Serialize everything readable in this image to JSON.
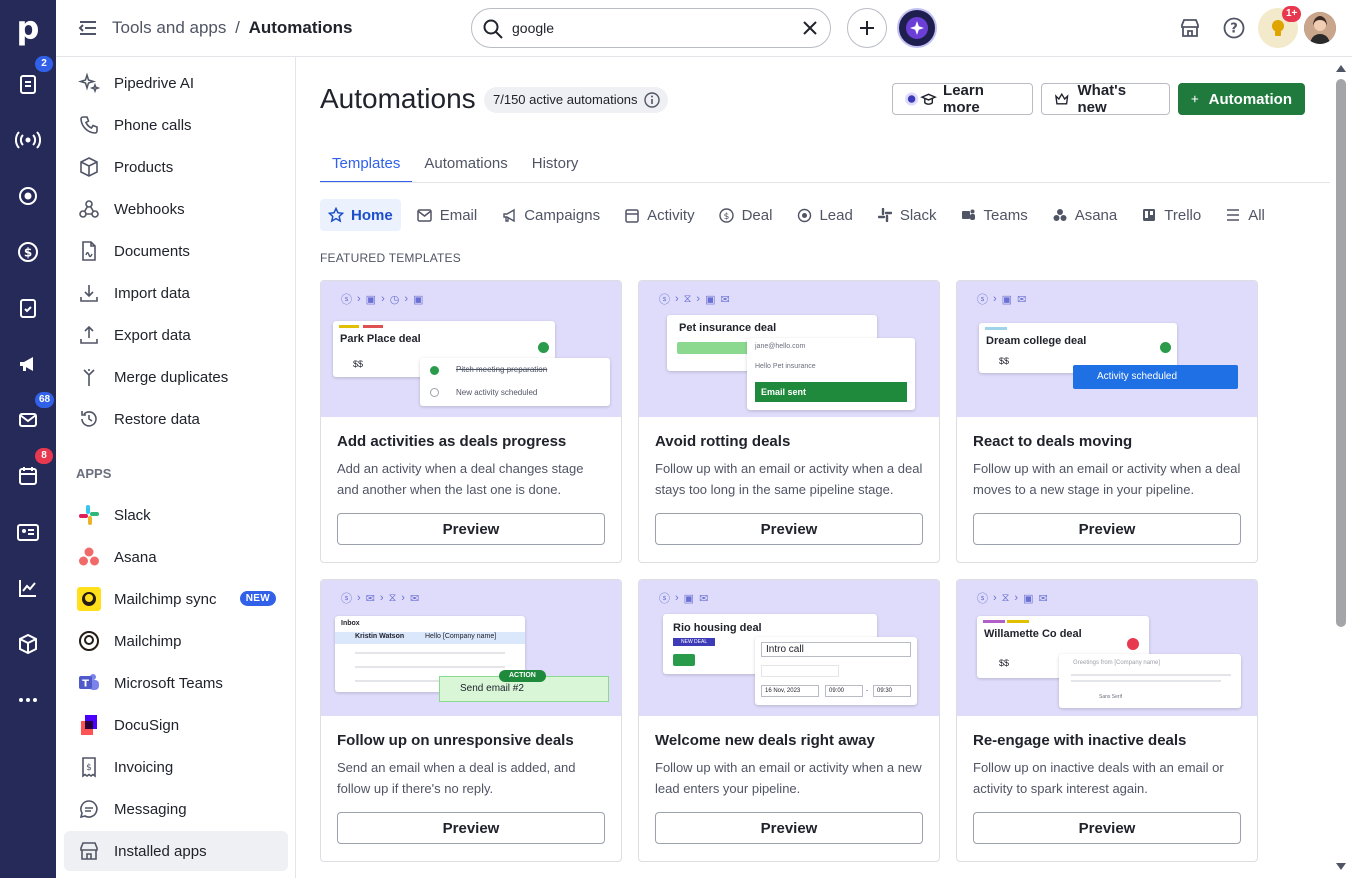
{
  "rail": {
    "logo": "p",
    "badges": {
      "deals": "2",
      "mail": "68",
      "calendar": "8"
    }
  },
  "topbar": {
    "breadcrumb_parent": "Tools and apps",
    "breadcrumb_sep": "/",
    "breadcrumb_current": "Automations",
    "search_value": "google",
    "notif_badge": "1+"
  },
  "sidebar": {
    "items": [
      "Pipedrive AI",
      "Phone calls",
      "Products",
      "Webhooks",
      "Documents",
      "Import data",
      "Export data",
      "Merge duplicates",
      "Restore data"
    ],
    "apps_header": "APPS",
    "apps": [
      "Slack",
      "Asana",
      "Mailchimp sync",
      "Mailchimp",
      "Microsoft Teams",
      "DocuSign",
      "Invoicing",
      "Messaging",
      "Installed apps"
    ],
    "new_badge": "NEW"
  },
  "main": {
    "title": "Automations",
    "count": "7/150 active automations",
    "learn_more": "Learn more",
    "whats_new": "What's new",
    "add_automation": "Automation",
    "tabs": [
      "Templates",
      "Automations",
      "History"
    ],
    "chips": [
      "Home",
      "Email",
      "Campaigns",
      "Activity",
      "Deal",
      "Lead",
      "Slack",
      "Teams",
      "Asana",
      "Trello",
      "All"
    ],
    "featured": "FEATURED TEMPLATES",
    "preview": "Preview",
    "cards": [
      {
        "title": "Add activities as deals progress",
        "desc": "Add an activity when a deal changes stage and another when the last one is done.",
        "mock_title": "Park Place deal",
        "mock_val": "$$",
        "mock_a": "Pitch meeting preparation",
        "mock_b": "New activity scheduled"
      },
      {
        "title": "Avoid rotting deals",
        "desc": "Follow up with an email or activity when a deal stays too long in the same pipeline stage.",
        "mock_title": "Pet insurance deal",
        "mock_a": "jane@hello.com",
        "mock_b": "Hello Pet insurance",
        "mock_c": "Email sent"
      },
      {
        "title": "React to deals moving",
        "desc": "Follow up with an email or activity when a deal moves to a new stage in your pipeline.",
        "mock_title": "Dream college deal",
        "mock_val": "$$",
        "mock_a": "Activity scheduled"
      },
      {
        "title": "Follow up on unresponsive deals",
        "desc": "Send an email when a deal is added, and follow up if there's no reply.",
        "mock_a": "Inbox",
        "mock_b": "Kristin Watson",
        "mock_c": "Hello [Company name]",
        "mock_d": "ACTION",
        "mock_e": "Send email #2"
      },
      {
        "title": "Welcome new deals right away",
        "desc": "Follow up with an email or activity when a new lead enters your pipeline.",
        "mock_title": "Rio housing deal",
        "mock_a": "NEW DEAL",
        "mock_b": "Intro call",
        "mock_c": "16 Nov, 2023",
        "mock_d": "09:00",
        "mock_e": "09:30",
        "mock_f": "-"
      },
      {
        "title": "Re-engage with inactive deals",
        "desc": "Follow up on inactive deals with an email or activity to spark interest again.",
        "mock_title": "Willamette Co deal",
        "mock_val": "$$",
        "mock_a": "Greetings from [Company name]",
        "mock_b": "Sans Serif"
      }
    ]
  },
  "colors": {
    "rail": "#262a59",
    "accent": "#3161e8",
    "primary": "#207a3d",
    "art_bg": "#dedcfa"
  }
}
